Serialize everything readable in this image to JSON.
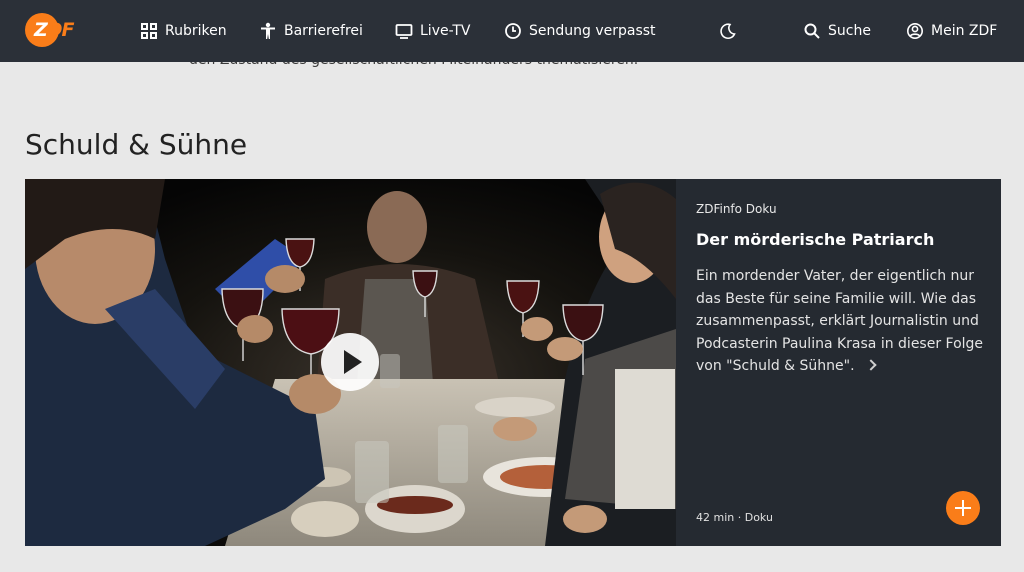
{
  "header": {
    "logo": {
      "text_main": "Z",
      "text_accent": "DF",
      "icon": "zdf-logo-icon"
    },
    "nav": [
      {
        "label": "Rubriken",
        "icon": "grid-icon"
      },
      {
        "label": "Barrierefrei",
        "icon": "accessibility-icon"
      },
      {
        "label": "Live-TV",
        "icon": "tv-icon"
      },
      {
        "label": "Sendung verpasst",
        "icon": "clock-icon"
      }
    ],
    "dark_mode_icon": "moon-icon",
    "search_label": "Suche",
    "account_label": "Mein ZDF"
  },
  "intro_text_clipped": "den Zustand des gesellschaftlichen Miteinanders thematisieren.",
  "section": {
    "title": "Schuld & Sühne",
    "teaser": {
      "kicker": "ZDFinfo Doku",
      "title": "Der mörderische Patriarch",
      "description": "Ein mordender Vater, der eigentlich nur das Beste für seine Familie will. Wie das zusammenpasst, erklärt Journalistin und Podcasterin Paulina Krasa in dieser Folge von \"Schuld & Sühne\".",
      "meta": "42 min · Doku",
      "add_icon": "plus-icon",
      "play_icon": "play-icon"
    }
  },
  "colors": {
    "header_bg": "#2b3038",
    "accent": "#fa7d19",
    "teaser_bg": "#252a31",
    "page_bg": "#e8e8e8"
  }
}
